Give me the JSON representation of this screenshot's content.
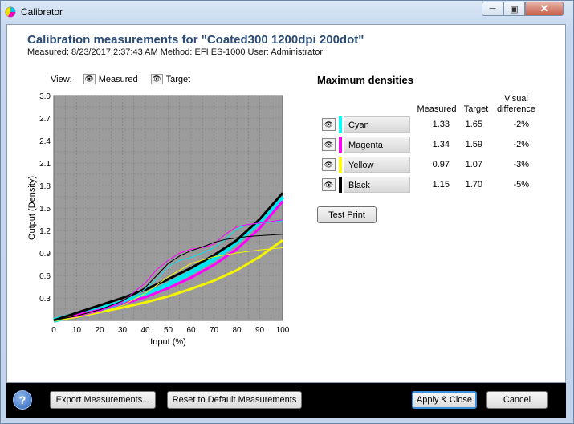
{
  "window": {
    "title": "Calibrator"
  },
  "header": {
    "title": "Calibration measurements for \"Coated300 1200dpi  200dot\"",
    "meta": "Measured: 8/23/2017 2:37:43 AM   Method: EFI ES-1000   User: Administrator"
  },
  "view": {
    "label": "View:",
    "measured": "Measured",
    "target": "Target"
  },
  "chart_data": {
    "type": "line",
    "xlabel": "Input (%)",
    "ylabel": "Output (Density)",
    "xlim": [
      0,
      100
    ],
    "ylim": [
      0,
      3.0
    ],
    "x_ticks": [
      "0",
      "10",
      "20",
      "30",
      "40",
      "50",
      "60",
      "70",
      "80",
      "90",
      "100"
    ],
    "y_ticks": [
      "0.3",
      "0.6",
      "0.9",
      "1.2",
      "1.5",
      "1.8",
      "2.1",
      "2.4",
      "2.7",
      "3.0"
    ],
    "grid": true,
    "series": [
      {
        "name": "Cyan",
        "kind": "target",
        "color": "#00e5ee",
        "x": [
          0,
          10,
          20,
          30,
          40,
          50,
          60,
          70,
          80,
          90,
          100
        ],
        "y": [
          0,
          0.08,
          0.16,
          0.24,
          0.34,
          0.48,
          0.64,
          0.82,
          1.05,
          1.32,
          1.65
        ]
      },
      {
        "name": "Magenta",
        "kind": "target",
        "color": "#ff00ff",
        "x": [
          0,
          10,
          20,
          30,
          40,
          50,
          60,
          70,
          80,
          90,
          100
        ],
        "y": [
          0,
          0.07,
          0.14,
          0.22,
          0.31,
          0.43,
          0.57,
          0.74,
          0.95,
          1.23,
          1.59
        ]
      },
      {
        "name": "Yellow",
        "kind": "target",
        "color": "#f5f500",
        "x": [
          0,
          10,
          20,
          30,
          40,
          50,
          60,
          70,
          80,
          90,
          100
        ],
        "y": [
          0,
          0.05,
          0.11,
          0.17,
          0.24,
          0.32,
          0.42,
          0.53,
          0.67,
          0.85,
          1.07
        ]
      },
      {
        "name": "Black",
        "kind": "target",
        "color": "#000000",
        "x": [
          0,
          10,
          20,
          30,
          40,
          50,
          60,
          70,
          80,
          90,
          100
        ],
        "y": [
          0,
          0.1,
          0.2,
          0.3,
          0.41,
          0.55,
          0.7,
          0.87,
          1.07,
          1.35,
          1.7
        ]
      },
      {
        "name": "Cyan",
        "kind": "measured",
        "color": "#00e5ee",
        "x": [
          0,
          10,
          20,
          30,
          40,
          45,
          50,
          55,
          60,
          65,
          70,
          75,
          80,
          85,
          90,
          95,
          100
        ],
        "y": [
          0,
          0.05,
          0.12,
          0.22,
          0.42,
          0.55,
          0.72,
          0.8,
          0.84,
          0.9,
          0.97,
          1.08,
          1.22,
          1.28,
          1.3,
          1.31,
          1.33
        ]
      },
      {
        "name": "Magenta",
        "kind": "measured",
        "color": "#ff00ff",
        "x": [
          0,
          10,
          20,
          30,
          40,
          45,
          50,
          55,
          60,
          65,
          70,
          75,
          80,
          85,
          90,
          95,
          100
        ],
        "y": [
          0,
          0.05,
          0.12,
          0.25,
          0.5,
          0.68,
          0.8,
          0.9,
          0.95,
          0.97,
          1.02,
          1.15,
          1.25,
          1.28,
          1.3,
          1.32,
          1.34
        ]
      },
      {
        "name": "Yellow",
        "kind": "measured",
        "color": "#f5f500",
        "x": [
          0,
          10,
          20,
          30,
          40,
          50,
          60,
          70,
          80,
          90,
          100
        ],
        "y": [
          0,
          0.04,
          0.1,
          0.2,
          0.36,
          0.58,
          0.76,
          0.85,
          0.9,
          0.94,
          0.97
        ]
      },
      {
        "name": "Black",
        "kind": "measured",
        "color": "#000000",
        "x": [
          0,
          10,
          20,
          30,
          40,
          45,
          50,
          55,
          60,
          65,
          70,
          75,
          80,
          85,
          90,
          95,
          100
        ],
        "y": [
          0,
          0.06,
          0.14,
          0.26,
          0.44,
          0.6,
          0.76,
          0.86,
          0.93,
          0.98,
          1.04,
          1.08,
          1.1,
          1.12,
          1.13,
          1.14,
          1.15
        ]
      }
    ]
  },
  "max_densities": {
    "title": "Maximum densities",
    "col_measured": "Measured",
    "col_target": "Target",
    "col_visual_1": "Visual",
    "col_visual_2": "difference",
    "rows": [
      {
        "name": "Cyan",
        "color": "#00ffff",
        "measured": "1.33",
        "target": "1.65",
        "diff": "-2%"
      },
      {
        "name": "Magenta",
        "color": "#ff00ff",
        "measured": "1.34",
        "target": "1.59",
        "diff": "-2%"
      },
      {
        "name": "Yellow",
        "color": "#ffff00",
        "measured": "0.97",
        "target": "1.07",
        "diff": "-3%"
      },
      {
        "name": "Black",
        "color": "#000000",
        "measured": "1.15",
        "target": "1.70",
        "diff": "-5%"
      }
    ],
    "test_print": "Test Print"
  },
  "footer": {
    "help": "?",
    "export": "Export Measurements...",
    "reset": "Reset to Default Measurements",
    "apply": "Apply & Close",
    "cancel": "Cancel"
  }
}
